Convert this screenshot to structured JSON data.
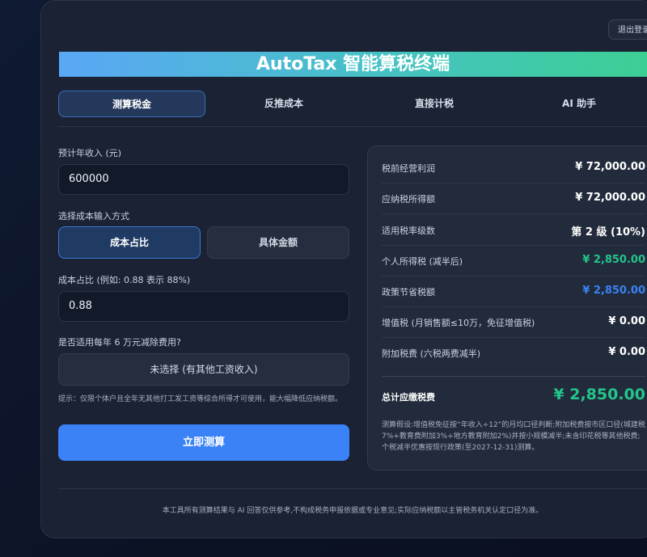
{
  "header": {
    "logout_label": "退出登录",
    "title": "AutoTax 智能算税终端"
  },
  "tabs": [
    {
      "label": "测算税金",
      "active": true
    },
    {
      "label": "反推成本",
      "active": false
    },
    {
      "label": "直接计税",
      "active": false
    },
    {
      "label": "AI 助手",
      "active": false
    }
  ],
  "form": {
    "income_label": "预计年收入 (元)",
    "income_value": "600000",
    "cost_mode_label": "选择成本输入方式",
    "cost_mode_options": [
      "成本占比",
      "具体金额"
    ],
    "cost_mode_selected": "成本占比",
    "ratio_label": "成本占比 (例如: 0.88 表示 88%)",
    "ratio_value": "0.88",
    "deduction_label": "是否适用每年 6 万元减除费用?",
    "deduction_value": "未选择 (有其他工资收入)",
    "hint": "提示：仅限个体户且全年无其他打工发工资等综合所得才可使用，能大幅降低应纳税额。",
    "submit_label": "立即测算"
  },
  "results": {
    "rows": [
      {
        "label": "税前经营利润",
        "value": "¥ 72,000.00",
        "color": "#ffffff"
      },
      {
        "label": "应纳税所得额",
        "value": "¥ 72,000.00",
        "color": "#ffffff"
      },
      {
        "label": "适用税率级数",
        "value": "第 2 级 (10%)",
        "color": "#ffffff"
      },
      {
        "label": "个人所得税 (减半后)",
        "value": "¥ 2,850.00",
        "color": "#22c58b"
      },
      {
        "label": "政策节省税额",
        "value": "¥ 2,850.00",
        "color": "#3b82f6"
      },
      {
        "label": "增值税 (月销售额≤10万，免征增值税)",
        "value": "¥ 0.00",
        "color": "#ffffff"
      },
      {
        "label": "附加税费 (六税两费减半)",
        "value": "¥ 0.00",
        "color": "#ffffff"
      }
    ],
    "total_label": "总计应缴税费",
    "total_value": "¥ 2,850.00",
    "note": "测算假设:增值税免征按“年收入÷12”的月均口径判断;附加税费按市区口径(城建税7%+教育费附加3%+地方教育附加2%)并按小规模减半;未含印花税等其他税费;个税减半优惠按现行政策(至2027-12-31)测算。"
  },
  "footer": "本工具所有测算结果与 AI 回答仅供参考,不构成税务申报依据或专业意见;实际应纳税额以主管税务机关认定口径为准。"
}
